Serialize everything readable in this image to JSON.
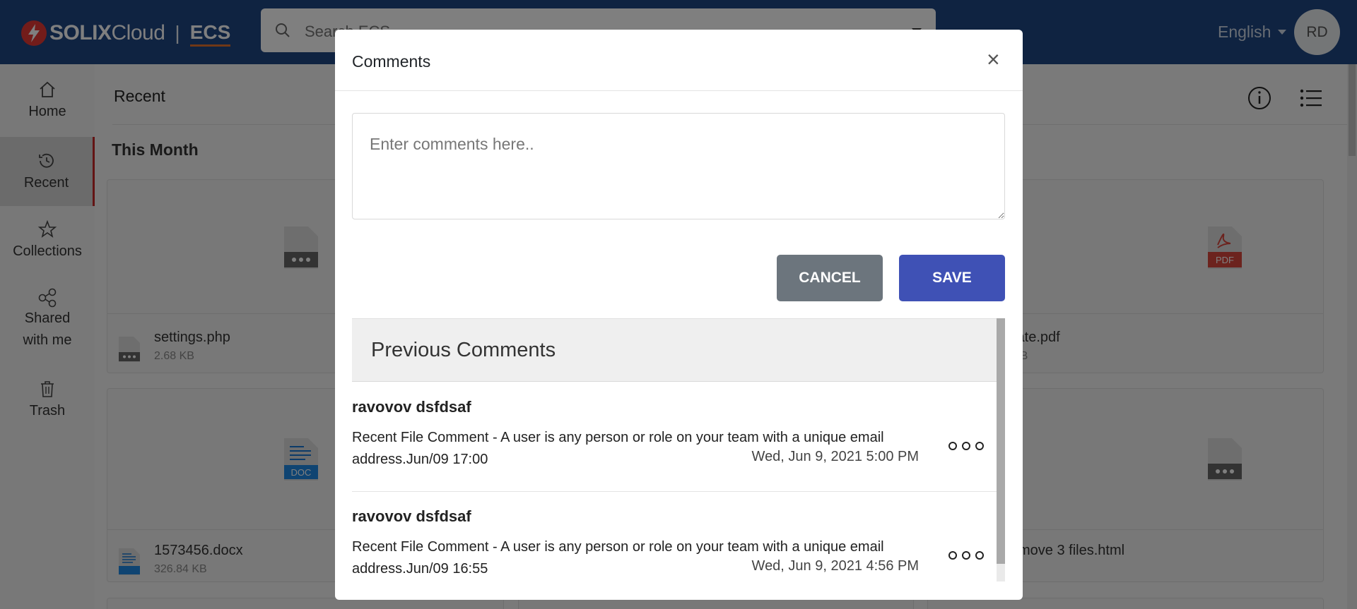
{
  "header": {
    "logo_brand": "SOLIX",
    "logo_cloud": "Cloud",
    "logo_sep": "|",
    "logo_product": "ECS",
    "search_placeholder": "Search ECS",
    "language": "English",
    "avatar_initials": "RD"
  },
  "sidebar": {
    "items": [
      {
        "label": "Home",
        "icon": "home-icon"
      },
      {
        "label": "Recent",
        "icon": "clock-icon"
      },
      {
        "label": "Collections",
        "icon": "star-icon"
      },
      {
        "label": "Shared\nwith me",
        "label_line1": "Shared",
        "label_line2": "with me",
        "icon": "share-icon"
      },
      {
        "label": "Trash",
        "icon": "trash-icon"
      }
    ]
  },
  "content": {
    "breadcrumb": "Recent",
    "section_title": "This Month",
    "files": [
      {
        "name": "settings.php",
        "size": "2.68 KB",
        "type": "generic"
      },
      {
        "name": "tate.pdf",
        "size": "KB",
        "type": "pdf"
      },
      {
        "name": "1573456.docx",
        "size": "326.84 KB",
        "type": "doc"
      },
      {
        "name": "move 3 files.html",
        "size": "",
        "type": "generic"
      }
    ],
    "pdf_badge": "PDF",
    "doc_badge": "DOC"
  },
  "modal": {
    "title": "Comments",
    "close_glyph": "×",
    "textarea_placeholder": "Enter comments here..",
    "cancel_label": "CANCEL",
    "save_label": "SAVE",
    "previous_title": "Previous Comments",
    "comments": [
      {
        "author": "ravovov dsfdsaf",
        "text": "Recent File Comment - A user is any person or role on your team with a unique email address.Jun/09 17:00",
        "date": "Wed, Jun 9, 2021 5:00 PM"
      },
      {
        "author": "ravovov dsfdsaf",
        "text": "Recent File Comment - A user is any person or role on your team with a unique email address.Jun/09 16:55",
        "date": "Wed, Jun 9, 2021 4:56 PM"
      }
    ]
  },
  "colors": {
    "header_bg": "#1f4683",
    "save_button": "#3f51b5",
    "cancel_button": "#6c757d",
    "active_indicator": "#c62828"
  }
}
